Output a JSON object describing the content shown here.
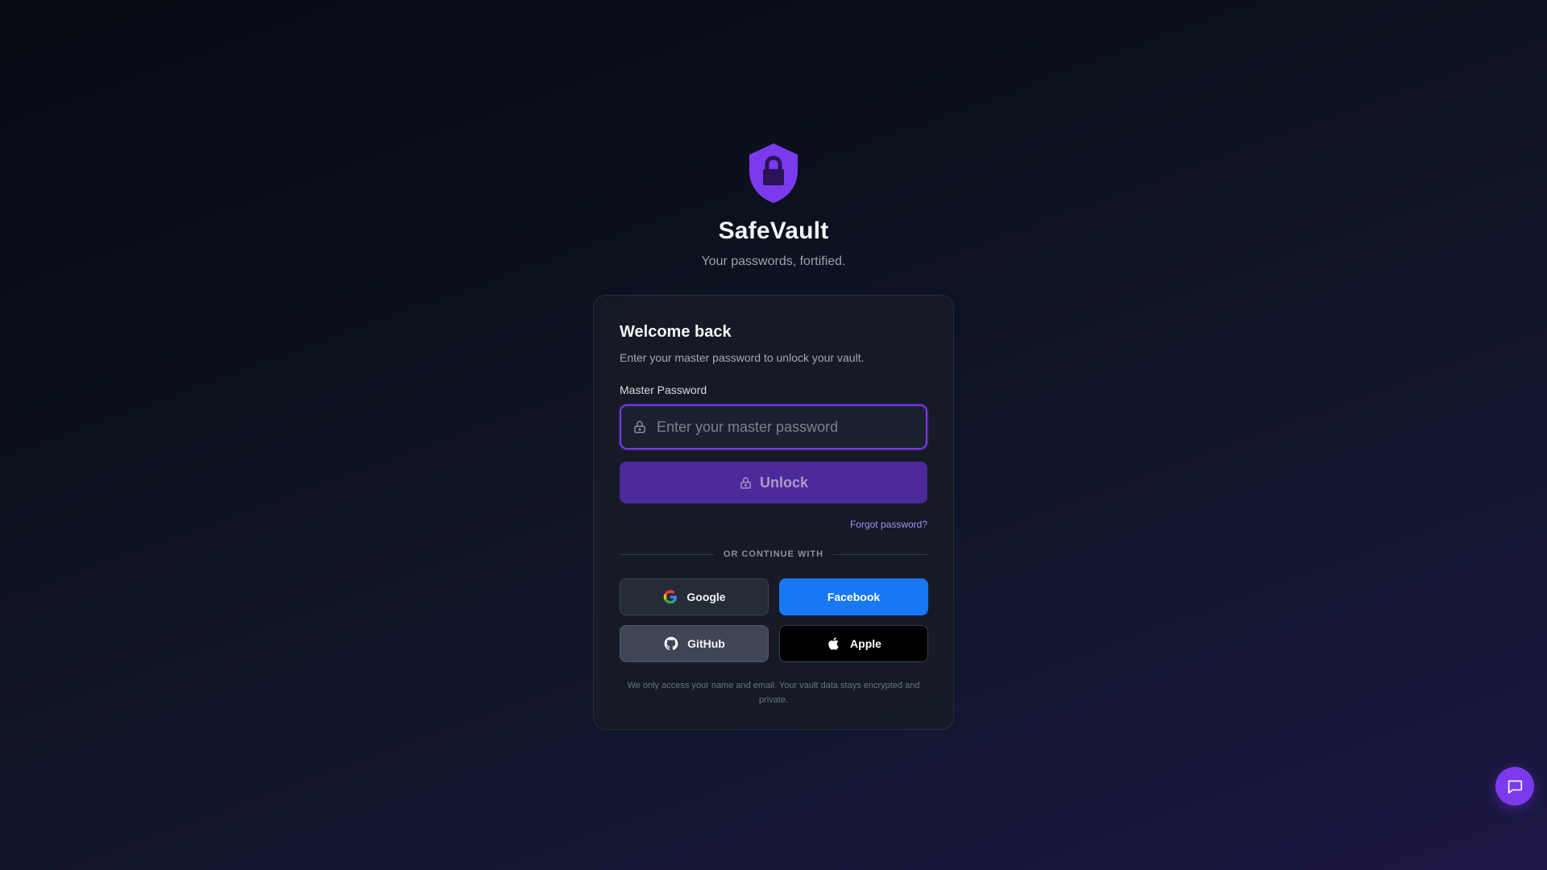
{
  "brand": {
    "title": "SafeVault",
    "tagline": "Your passwords, fortified.",
    "logo_icon": "shield-lock-icon",
    "accent_color": "#7c3aed"
  },
  "login_card": {
    "title": "Welcome back",
    "subtitle": "Enter your master password to unlock your vault.",
    "password_label": "Master Password",
    "password_placeholder": "Enter your master password",
    "password_value": "",
    "unlock_label": "Unlock",
    "forgot_label": "Forgot password?",
    "divider_label": "OR CONTINUE WITH",
    "social": {
      "google": "Google",
      "facebook": "Facebook",
      "github": "GitHub",
      "apple": "Apple"
    },
    "privacy_note": "We only access your name and email. Your vault data stays encrypted and private."
  },
  "colors": {
    "facebook": "#1877f2",
    "unlock_button": "#4c2a99",
    "link": "#a78bfa"
  },
  "chat": {
    "icon": "chat-bubble-icon"
  }
}
